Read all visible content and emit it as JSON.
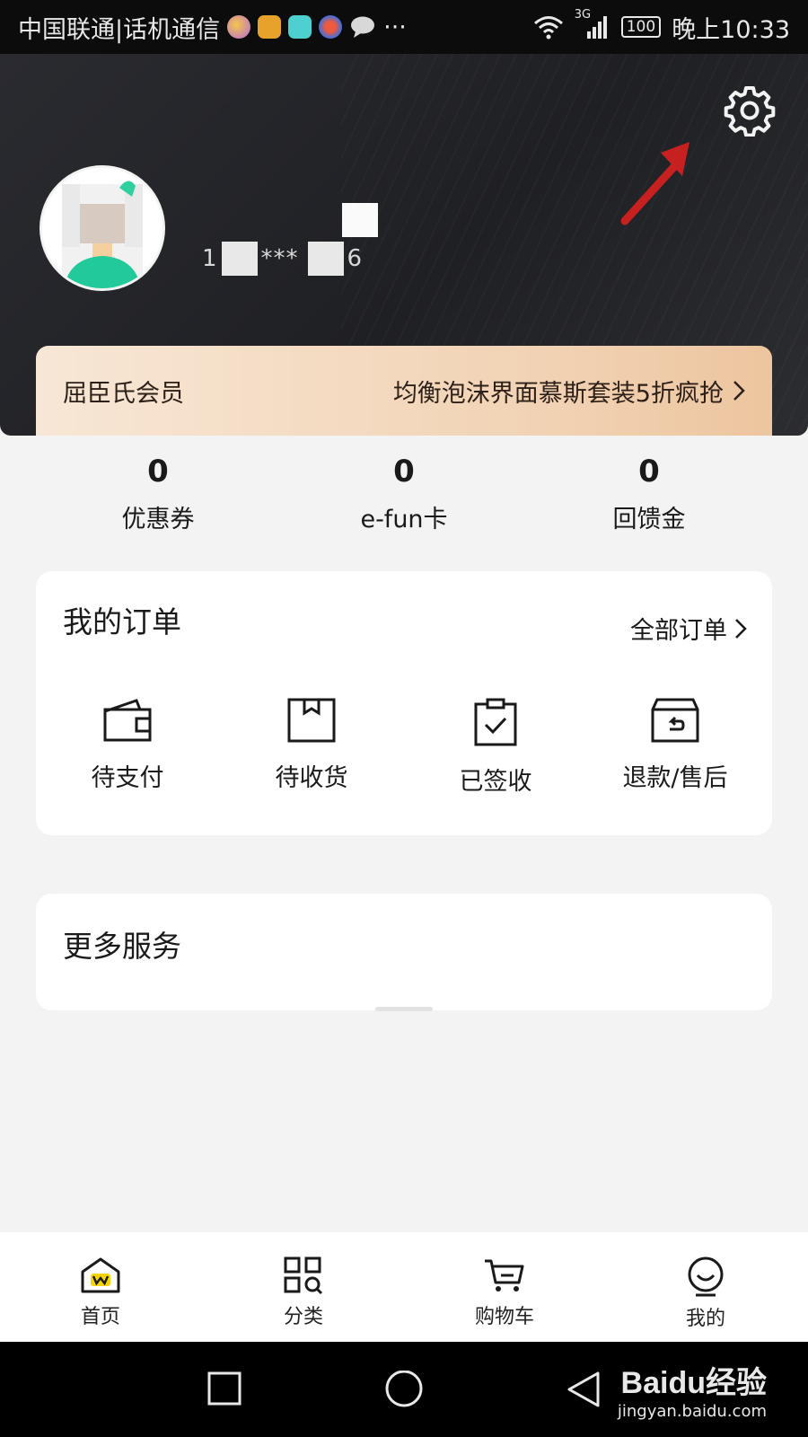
{
  "status_bar": {
    "carrier": "中国联通|话机通信",
    "more": "···",
    "network": "3G",
    "battery": "100",
    "time": "晚上10:33"
  },
  "profile": {
    "phone_prefix": "1",
    "phone_mid": "***",
    "phone_suffix": "6"
  },
  "member_banner": {
    "title": "屈臣氏会员",
    "promo": "均衡泡沫界面慕斯套装5折疯抢"
  },
  "stats": [
    {
      "value": "0",
      "label": "优惠券"
    },
    {
      "value": "0",
      "label": "e-fun卡"
    },
    {
      "value": "0",
      "label": "回馈金"
    }
  ],
  "orders": {
    "title": "我的订单",
    "all_orders": "全部订单",
    "items": [
      {
        "label": "待支付",
        "icon": "wallet-icon"
      },
      {
        "label": "待收货",
        "icon": "box-icon"
      },
      {
        "label": "已签收",
        "icon": "clipboard-check-icon"
      },
      {
        "label": "退款/售后",
        "icon": "return-box-icon"
      }
    ]
  },
  "services": {
    "title": "更多服务"
  },
  "tab_bar": [
    {
      "label": "首页",
      "icon": "home-icon"
    },
    {
      "label": "分类",
      "icon": "category-icon"
    },
    {
      "label": "购物车",
      "icon": "cart-icon"
    },
    {
      "label": "我的",
      "icon": "smile-icon"
    }
  ],
  "watermark": {
    "brand": "Baidu经验",
    "url": "jingyan.baidu.com"
  },
  "colors": {
    "header_bg": "#232428",
    "member_gradient_start": "#f7e7d6",
    "member_gradient_end": "#edc59f",
    "arrow": "#c62020",
    "page_bg": "#f3f3f3",
    "home_accent": "#f5d400"
  }
}
